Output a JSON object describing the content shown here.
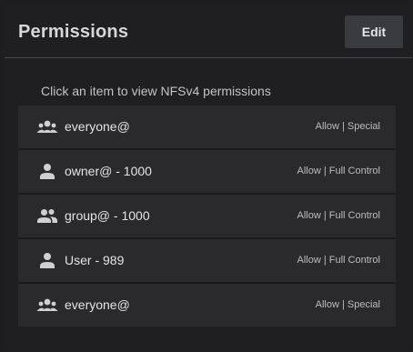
{
  "card": {
    "title": "Permissions",
    "edit_label": "Edit"
  },
  "hint": "Click an item to view NFSv4 permissions",
  "items": [
    {
      "name": "everyone@",
      "perm": "Allow | Special",
      "icon": "group-icon"
    },
    {
      "name": "owner@ - 1000",
      "perm": "Allow | Full Control",
      "icon": "person-icon"
    },
    {
      "name": "group@ - 1000",
      "perm": "Allow | Full Control",
      "icon": "people-icon"
    },
    {
      "name": "User - 989",
      "perm": "Allow | Full Control",
      "icon": "person-icon"
    },
    {
      "name": "everyone@",
      "perm": "Allow | Special",
      "icon": "group-icon"
    }
  ],
  "colors": {
    "background": "#1f1f21",
    "item_background": "#2a2a2d",
    "button_background": "#3a3b3e",
    "text": "#e4e4e6",
    "icon": "#d0d0d2"
  }
}
